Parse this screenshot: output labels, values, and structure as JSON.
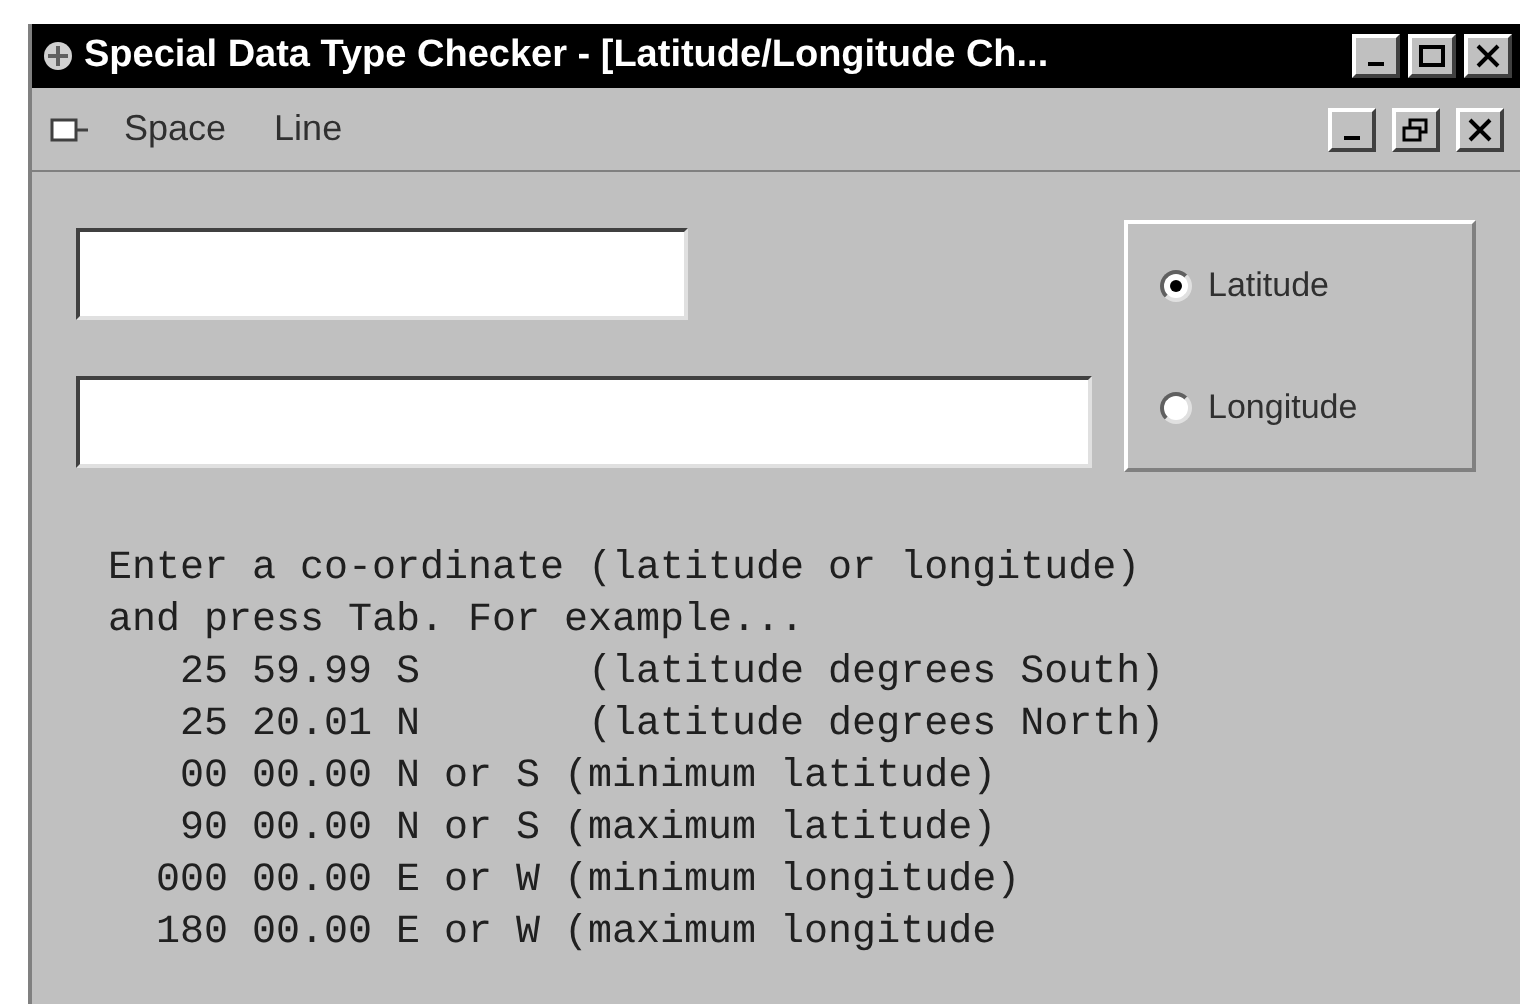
{
  "window": {
    "title": "Special Data Type Checker - [Latitude/Longitude Ch..."
  },
  "menu": {
    "items": [
      {
        "label": "Space"
      },
      {
        "label": "Line"
      }
    ]
  },
  "options": [
    {
      "label": "Latitude",
      "selected": true
    },
    {
      "label": "Longitude",
      "selected": false
    }
  ],
  "instructions": [
    "Enter a co-ordinate (latitude or longitude)",
    "and press Tab. For example...",
    "   25 59.99 S       (latitude degrees South)",
    "   25 20.01 N       (latitude degrees North)",
    "   00 00.00 N or S (minimum latitude)",
    "   90 00.00 N or S (maximum latitude)",
    "  000 00.00 E or W (minimum longitude)",
    "  180 00.00 E or W (maximum longitude"
  ]
}
